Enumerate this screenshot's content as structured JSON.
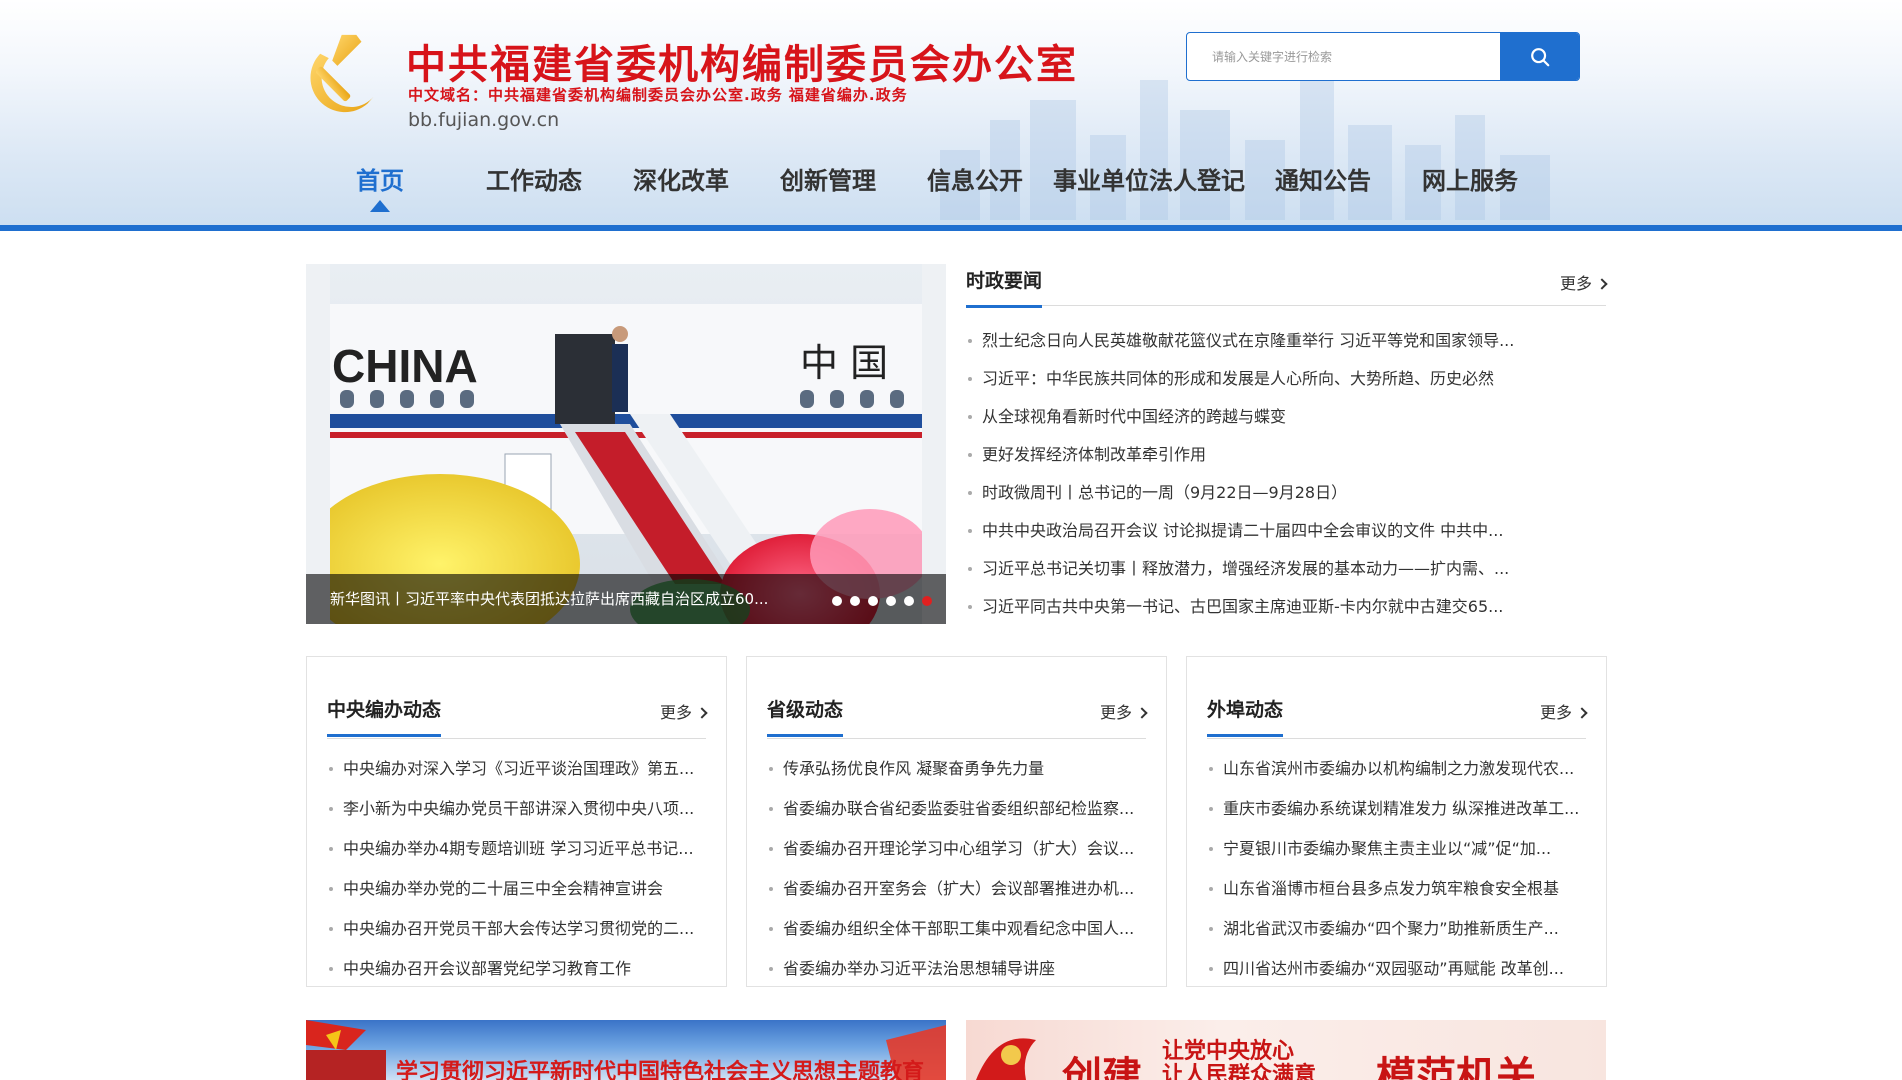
{
  "header": {
    "title": "中共福建省委机构编制委员会办公室",
    "domain_line": "中文域名：中共福建省委机构编制委员会办公室.政务   福建省编办.政务",
    "url": "bb.fujian.gov.cn"
  },
  "search": {
    "placeholder": "请输入关键字进行检索"
  },
  "nav": {
    "items": [
      {
        "label": "首页",
        "active": true
      },
      {
        "label": "工作动态"
      },
      {
        "label": "深化改革"
      },
      {
        "label": "创新管理"
      },
      {
        "label": "信息公开"
      },
      {
        "label": "事业单位法人登记"
      },
      {
        "label": "通知公告"
      },
      {
        "label": "网上服务"
      }
    ]
  },
  "slider": {
    "caption": "新华图讯丨习近平率中央代表团抵达拉萨出席西藏自治区成立60...",
    "dots": 6,
    "active_dot": 6
  },
  "politics": {
    "title": "时政要闻",
    "more": "更多",
    "items": [
      "烈士纪念日向人民英雄敬献花篮仪式在京隆重举行 习近平等党和国家领导...",
      "习近平：中华民族共同体的形成和发展是人心所向、大势所趋、历史必然",
      "从全球视角看新时代中国经济的跨越与蝶变",
      "更好发挥经济体制改革牵引作用",
      "时政微周刊丨总书记的一周（9月22日—9月28日）",
      "中共中央政治局召开会议 讨论拟提请二十届四中全会审议的文件 中共中...",
      "习近平总书记关切事丨释放潜力，增强经济发展的基本动力——扩内需、...",
      "习近平同古共中央第一书记、古巴国家主席迪亚斯-卡内尔就中古建交65..."
    ]
  },
  "central": {
    "title": "中央编办动态",
    "more": "更多",
    "items": [
      "中央编办对深入学习《习近平谈治国理政》第五...",
      "李小新为中央编办党员干部讲深入贯彻中央八项...",
      "中央编办举办4期专题培训班 学习习近平总书记...",
      "中央编办举办党的二十届三中全会精神宣讲会",
      "中央编办召开党员干部大会传达学习贯彻党的二...",
      "中央编办召开会议部署党纪学习教育工作"
    ]
  },
  "provincial": {
    "title": "省级动态",
    "more": "更多",
    "items": [
      "传承弘扬优良作风 凝聚奋勇争先力量",
      "省委编办联合省纪委监委驻省委组织部纪检监察...",
      "省委编办召开理论学习中心组学习（扩大）会议...",
      "省委编办召开室务会（扩大）会议部署推进办机...",
      "省委编办组织全体干部职工集中观看纪念中国人...",
      "省委编办举办习近平法治思想辅导讲座"
    ]
  },
  "external": {
    "title": "外埠动态",
    "more": "更多",
    "items": [
      "山东省滨州市委编办以机构编制之力激发现代农...",
      "重庆市委编办系统谋划精准发力 纵深推进改革工...",
      "宁夏银川市委编办聚焦主责主业以“减”促“加...",
      "山东省淄博市桓台县多点发力筑牢粮食安全根基",
      "湖北省武汉市委编办“四个聚力”助推新质生产...",
      "四川省达州市委编办“双园驱动”再赋能 改革创..."
    ]
  },
  "banners": {
    "left_text": "学习贯彻习近平新时代中国特色社会主义思想主题教育",
    "right_big_1": "创建",
    "right_small_1": "让党中央放心",
    "right_small_2": "让人民群众满意",
    "right_big_2": "模范机关"
  },
  "colors": {
    "brand_red": "#d7141a",
    "brand_blue": "#1f6fcf"
  },
  "icons": {
    "emblem": "party-emblem-icon",
    "search": "search-icon",
    "more": "chevron-right-icon"
  }
}
